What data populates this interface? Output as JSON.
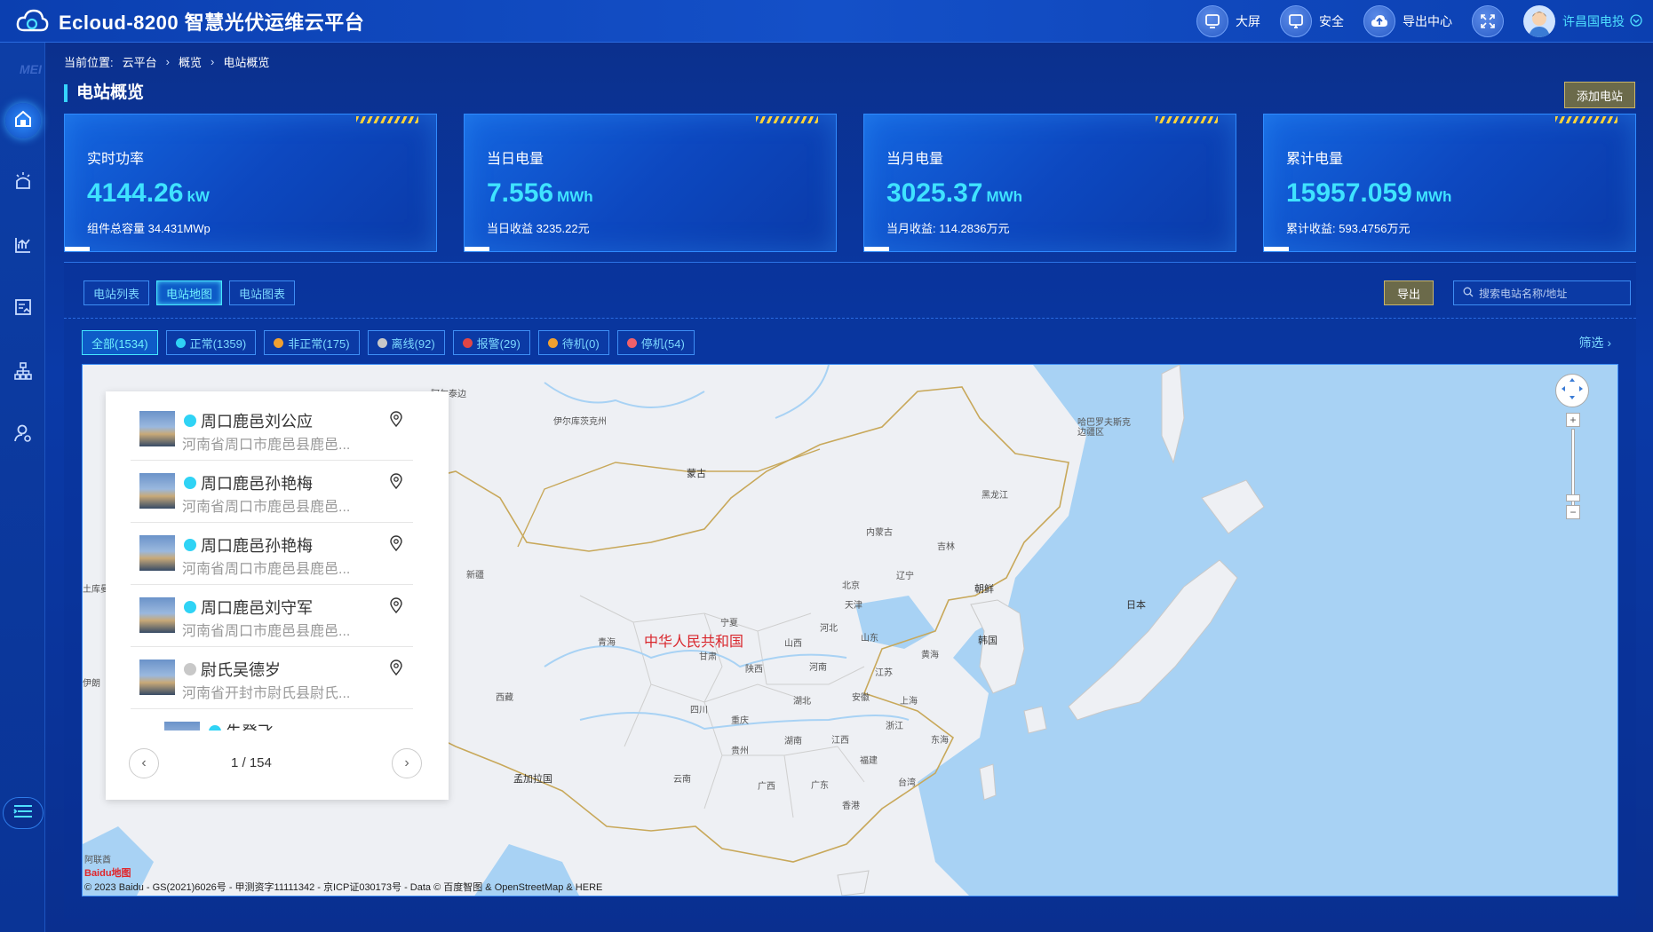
{
  "header": {
    "title": "Ecloud-8200 智慧光伏运维云平台",
    "actions": [
      {
        "label": "大屏",
        "icon": "monitor-icon"
      },
      {
        "label": "安全",
        "icon": "shield-icon"
      },
      {
        "label": "导出中心",
        "icon": "cloud-upload-icon"
      },
      {
        "label": "",
        "icon": "fullscreen-icon"
      }
    ],
    "user": "许昌国电投"
  },
  "sidebar": {
    "items": [
      "home-icon",
      "device-icon",
      "chart-icon",
      "report-icon",
      "org-icon",
      "user-settings-icon"
    ],
    "watermark": "MEI"
  },
  "breadcrumb": {
    "label": "当前位置:",
    "items": [
      "云平台",
      "概览",
      "电站概览"
    ]
  },
  "page": {
    "title": "电站概览",
    "add_button": "添加电站"
  },
  "cards": [
    {
      "label": "实时功率",
      "value": "4144.26",
      "unit": "kW",
      "sub": "组件总容量 34.431MWp"
    },
    {
      "label": "当日电量",
      "value": "7.556",
      "unit": "MWh",
      "sub": "当日收益 3235.22元"
    },
    {
      "label": "当月电量",
      "value": "3025.37",
      "unit": "MWh",
      "sub": "当月收益: 114.2836万元"
    },
    {
      "label": "累计电量",
      "value": "15957.059",
      "unit": "MWh",
      "sub": "累计收益: 593.4756万元"
    }
  ],
  "tabs": [
    "电站列表",
    "电站地图",
    "电站图表"
  ],
  "toolbar": {
    "export": "导出",
    "search_placeholder": "搜索电站名称/地址"
  },
  "filters": [
    {
      "label": "全部(1534)",
      "color": ""
    },
    {
      "label": "正常(1359)",
      "color": "#2fd3f5"
    },
    {
      "label": "非正常(175)",
      "color": "#f0a030"
    },
    {
      "label": "离线(92)",
      "color": "#c8c8c8"
    },
    {
      "label": "报警(29)",
      "color": "#e04646"
    },
    {
      "label": "待机(0)",
      "color": "#f0a030"
    },
    {
      "label": "停机(54)",
      "color": "#f0606a"
    }
  ],
  "filter_link": "筛选",
  "stations": [
    {
      "name": "周口鹿邑刘公应",
      "address": "河南省周口市鹿邑县鹿邑...",
      "color": "#2fd3f5"
    },
    {
      "name": "周口鹿邑孙艳梅",
      "address": "河南省周口市鹿邑县鹿邑...",
      "color": "#2fd3f5"
    },
    {
      "name": "周口鹿邑孙艳梅",
      "address": "河南省周口市鹿邑县鹿邑...",
      "color": "#2fd3f5"
    },
    {
      "name": "周口鹿邑刘守军",
      "address": "河南省周口市鹿邑县鹿邑...",
      "color": "#2fd3f5"
    },
    {
      "name": "尉氏吴德岁",
      "address": "河南省开封市尉氏县尉氏...",
      "color": "#c8c8c8"
    },
    {
      "name": "朱登飞",
      "address": "",
      "color": "#2fd3f5"
    }
  ],
  "pager": {
    "text": "1 / 154"
  },
  "map": {
    "labels": {
      "china": "中华人民共和国",
      "mongolia": "蒙古",
      "japan": "日本",
      "korea": "韩国",
      "dprk": "朝鲜",
      "bangladesh": "孟加拉国",
      "huanghai": "黄海",
      "donghai": "东海",
      "heilongjiang": "黑龙江",
      "jilin": "吉林",
      "liaoning": "辽宁",
      "neimenggu": "内蒙古",
      "beijing": "北京",
      "tianjin": "天津",
      "hebei": "河北",
      "shanxi": "山西",
      "shandong": "山东",
      "henan": "河南",
      "jiangsu": "江苏",
      "anhui": "安徽",
      "shanghai": "上海",
      "hubei": "湖北",
      "zhejiang": "浙江",
      "hunan": "湖南",
      "jiangxi": "江西",
      "fujian": "福建",
      "taiwan": "台湾",
      "guangdong": "广东",
      "guangxi": "广西",
      "guizhou": "贵州",
      "yunnan": "云南",
      "sichuan": "四川",
      "chongqing": "重庆",
      "shaanxi": "陕西",
      "gansu": "甘肃",
      "ningxia": "宁夏",
      "qinghai": "青海",
      "xizang": "西藏",
      "xinjiang": "新疆",
      "hongkong": "香港",
      "iran": "伊朗",
      "kabul": "土库曼",
      "altai": "阿尔泰边疆区",
      "irkutsk": "伊尔库茨克州",
      "khabarovsk": "哈巴罗夫斯克边疆区"
    },
    "baidu": "Baidu地图",
    "copyright_left": "阿联酋",
    "copyright": "© 2023 Baidu - GS(2021)6026号 - 甲测资字11111342 - 京ICP证030173号 - Data © 百度智图 & OpenStreetMap & HERE"
  }
}
